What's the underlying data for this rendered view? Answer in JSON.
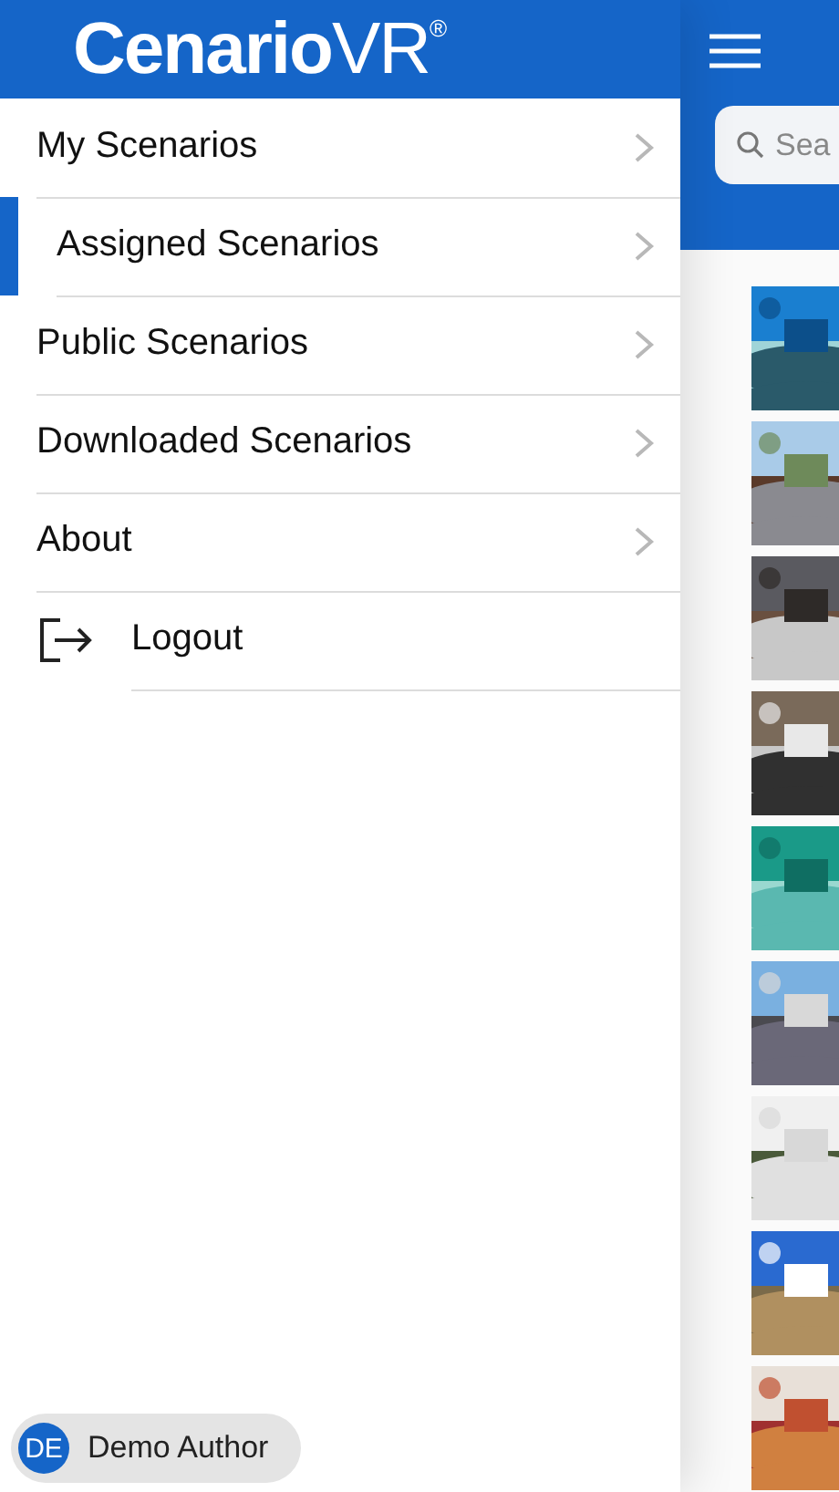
{
  "logo": "**Cenario**VR$^{®}$",
  "menu": {
    "items": [
      {
        "kind": "nav",
        "label": "My Scenarios",
        "selected": false
      },
      {
        "kind": "nav",
        "label": "Assigned Scenarios",
        "selected": true
      },
      {
        "kind": "nav",
        "label": "Public Scenarios",
        "selected": false
      },
      {
        "kind": "nav",
        "label": "Downloaded Scenarios",
        "selected": false
      },
      {
        "kind": "nav",
        "label": "About",
        "selected": false
      },
      {
        "kind": "logout",
        "label": "Logout",
        "selected": false
      }
    ]
  },
  "user": {
    "initials": "DE",
    "name": "Demo Author"
  },
  "search": {
    "placeholder": "Sea"
  }
}
